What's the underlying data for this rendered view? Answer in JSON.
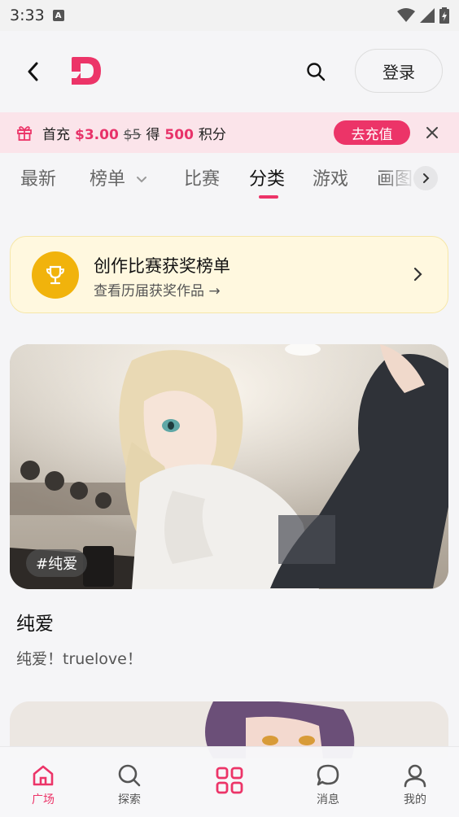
{
  "status_bar": {
    "time": "3:33",
    "indicator": "A"
  },
  "header": {
    "login_label": "登录"
  },
  "promo": {
    "text_prefix": "首充",
    "price": "$3.00",
    "old_price": "$5",
    "get_label": "得",
    "points": "500",
    "points_unit": "积分",
    "button_label": "去充值"
  },
  "tabs": [
    {
      "label": "最新"
    },
    {
      "label": "榜单"
    },
    {
      "label": "比赛"
    },
    {
      "label": "分类"
    },
    {
      "label": "游戏"
    },
    {
      "label": "画图"
    }
  ],
  "active_tab": "分类",
  "award_card": {
    "title": "创作比赛获奖榜单",
    "subtitle": "查看历届获奖作品 →"
  },
  "cards": [
    {
      "tag": "#纯爱",
      "title": "纯爱",
      "description": "纯爱！truelove！"
    }
  ],
  "bottom_nav": [
    {
      "label": "广场",
      "icon": "home-icon"
    },
    {
      "label": "探索",
      "icon": "search-icon"
    },
    {
      "label": "",
      "icon": "grid-icon"
    },
    {
      "label": "消息",
      "icon": "chat-icon"
    },
    {
      "label": "我的",
      "icon": "user-icon"
    }
  ],
  "colors": {
    "accent": "#ec3468",
    "promo_bg": "#fbe4ea",
    "award_bg": "#fff8df",
    "trophy": "#f1b30c"
  }
}
